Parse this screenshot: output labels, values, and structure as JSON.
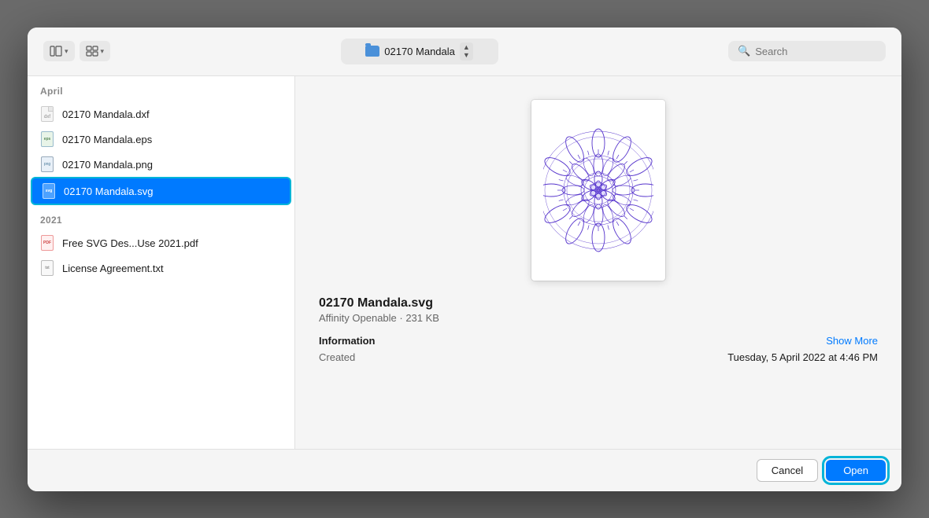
{
  "toolbar": {
    "view_column_label": "⊞",
    "view_grid_label": "⊟",
    "location": "02170 Mandala",
    "search_placeholder": "Search"
  },
  "file_list": {
    "groups": [
      {
        "label": "April",
        "items": [
          {
            "id": "dxf",
            "name": "02170 Mandala.dxf",
            "icon_type": "dxf",
            "selected": false
          },
          {
            "id": "eps",
            "name": "02170 Mandala.eps",
            "icon_type": "eps",
            "selected": false
          },
          {
            "id": "png",
            "name": "02170 Mandala.png",
            "icon_type": "png",
            "selected": false
          },
          {
            "id": "svg",
            "name": "02170 Mandala.svg",
            "icon_type": "svg",
            "selected": true
          }
        ]
      },
      {
        "label": "2021",
        "items": [
          {
            "id": "pdf",
            "name": "Free SVG Des...Use 2021.pdf",
            "icon_type": "pdf",
            "selected": false
          },
          {
            "id": "txt",
            "name": "License Agreement.txt",
            "icon_type": "txt",
            "selected": false
          }
        ]
      }
    ]
  },
  "preview": {
    "file_name": "02170 Mandala.svg",
    "file_meta": "Affinity Openable · 231 KB",
    "info_label": "Information",
    "show_more_label": "Show More",
    "created_label": "Created",
    "created_value": "Tuesday, 5 April 2022 at 4:46 PM"
  },
  "buttons": {
    "cancel_label": "Cancel",
    "open_label": "Open"
  }
}
